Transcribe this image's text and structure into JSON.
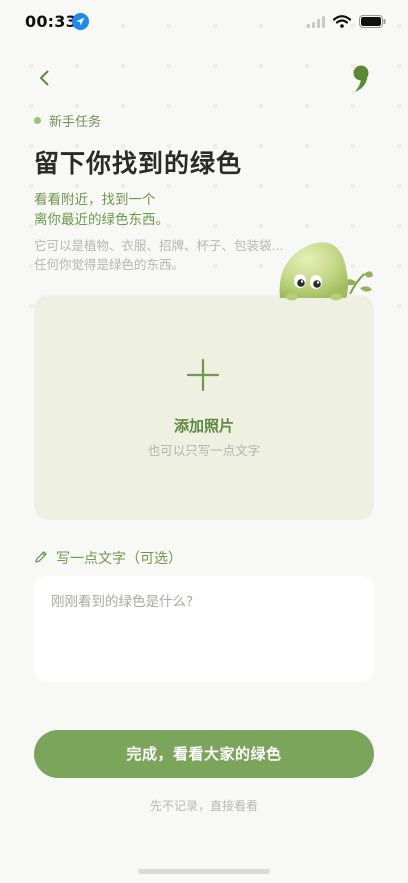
{
  "status_bar": {
    "time": "00:33"
  },
  "header": {
    "back_label": "",
    "brand": ","
  },
  "task": {
    "tag": "新手任务",
    "title": "留下你找到的绿色",
    "subtitle_line1": "看看附近，找到一个",
    "subtitle_line2": "离你最近的绿色东西。",
    "hint_line1": "它可以是植物、衣服、招牌、杯子、包装袋...",
    "hint_line2": "任何你觉得是绿色的东西。"
  },
  "photo_card": {
    "title": "添加照片",
    "subtitle": "也可以只写一点文字"
  },
  "note": {
    "label": "写一点文字（可选）",
    "placeholder": "刚刚看到的绿色是什么?"
  },
  "actions": {
    "primary_label": "完成，看看大家的绿色",
    "skip_label": "先不记录，直接看看"
  },
  "colors": {
    "accent": "#7aa55a",
    "accent_text": "#6d9a4a",
    "card_bg": "#eef0e2",
    "page_bg": "#f8f8f6"
  },
  "icons": {
    "back": "chevron-left-icon",
    "brand": "comma-logo-icon",
    "location": "location-arrow-icon",
    "signal": "cellular-signal-icon",
    "wifi": "wifi-icon",
    "battery": "battery-icon",
    "plus": "plus-icon",
    "pencil": "pencil-icon",
    "mascot": "green-blob-mascot-icon"
  }
}
